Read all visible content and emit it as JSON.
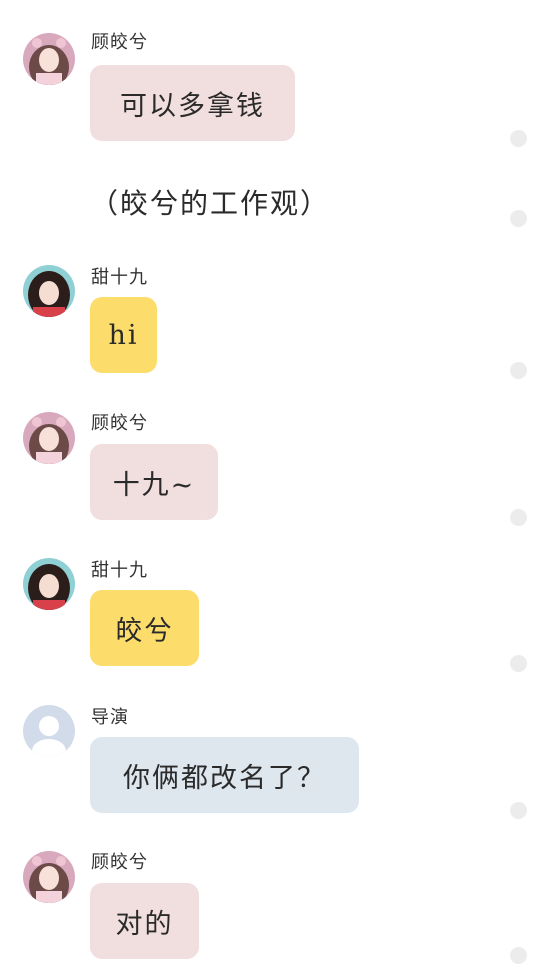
{
  "colors": {
    "pink_bubble": "#f1dede",
    "yellow_bubble": "#fcdc6a",
    "blue_bubble": "#dee6ee",
    "dot": "#ececec"
  },
  "messages": [
    {
      "speaker": "顾皎兮",
      "text": "可以多拿钱",
      "avatar": "girl-pink-avatar"
    },
    {
      "narration": "（皎兮的工作观）"
    },
    {
      "speaker": "甜十九",
      "text": "hi",
      "avatar": "girl-teal-avatar"
    },
    {
      "speaker": "顾皎兮",
      "text": "十九~",
      "avatar": "girl-pink-avatar"
    },
    {
      "speaker": "甜十九",
      "text": "皎兮",
      "avatar": "girl-teal-avatar"
    },
    {
      "speaker": "导演",
      "text": "你俩都改名了？",
      "avatar": "default-user-avatar"
    },
    {
      "speaker": "顾皎兮",
      "text": "对的",
      "avatar": "girl-pink-avatar"
    }
  ]
}
